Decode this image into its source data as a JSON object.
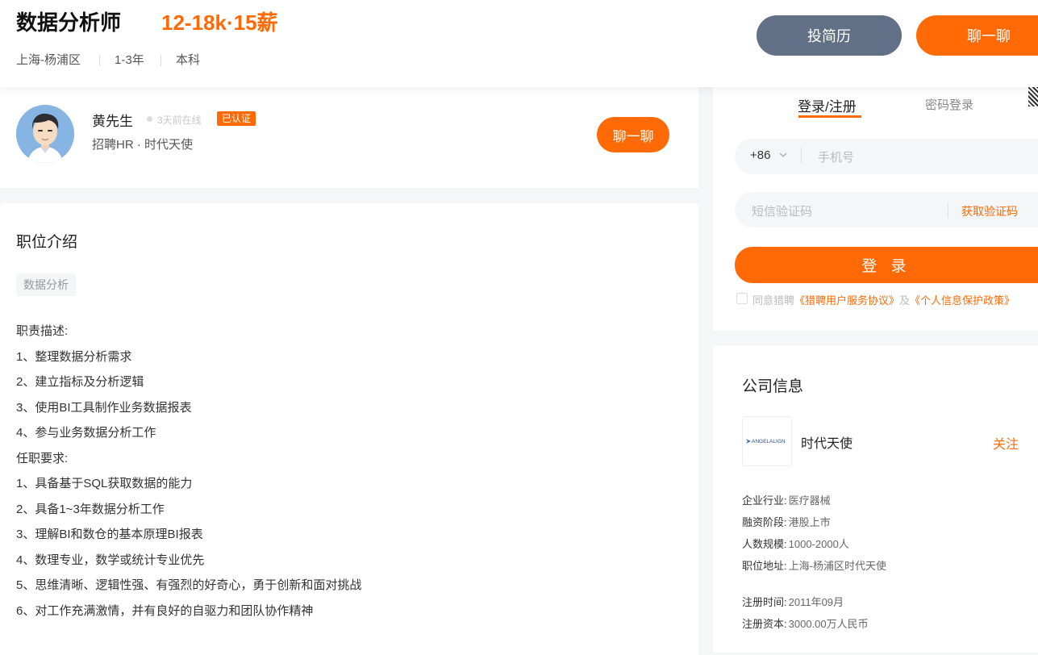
{
  "header": {
    "job_title": "数据分析师",
    "salary": "12-18k·15薪",
    "location": "上海-杨浦区",
    "experience": "1-3年",
    "education": "本科",
    "resume_button": "投简历",
    "chat_button": "聊一聊"
  },
  "recruiter": {
    "name": "黄先生",
    "online_status": "3天前在线",
    "verified_badge": "已认证",
    "role": "招聘HR · 时代天使",
    "chat_button": "聊一聊"
  },
  "job_description": {
    "section_title": "职位介绍",
    "tag": "数据分析",
    "lines": [
      "职责描述:",
      "1、整理数据分析需求",
      "2、建立指标及分析逻辑",
      "3、使用BI工具制作业务数据报表",
      "4、参与业务数据分析工作",
      "任职要求:",
      "1、具备基于SQL获取数据的能力",
      "2、具备1~3年数据分析工作",
      "3、理解BI和数仓的基本原理BI报表",
      "4、数理专业，数学或统计专业优先",
      "5、思维清晰、逻辑性强、有强烈的好奇心，勇于创新和面对挑战",
      "6、对工作充满激情，并有良好的自驱力和团队协作精神"
    ]
  },
  "login": {
    "tab_register": "登录/注册",
    "tab_password": "密码登录",
    "country_code": "+86",
    "phone_placeholder": "手机号",
    "sms_placeholder": "短信验证码",
    "get_code": "获取验证码",
    "login_button": "登 录",
    "agree_prefix": "同意猎聘",
    "agree_link1": "《猎聘用户服务协议》",
    "agree_mid": "及",
    "agree_link2": "《个人信息保护政策》"
  },
  "company": {
    "section_title": "公司信息",
    "logo_text": "ANGELALIGN",
    "name": "时代天使",
    "follow": "关注",
    "info": [
      {
        "label": "企业行业:",
        "value": "医疗器械"
      },
      {
        "label": "融资阶段:",
        "value": "港股上市"
      },
      {
        "label": "人数规模:",
        "value": "1000-2000人"
      },
      {
        "label": "职位地址:",
        "value": "上海-杨浦区时代天使"
      },
      {
        "label": "注册时间:",
        "value": "2011年09月"
      },
      {
        "label": "注册资本:",
        "value": "3000.00万人民币"
      }
    ]
  },
  "colors": {
    "accent": "#ff6a06",
    "secondary_button": "#617086"
  }
}
